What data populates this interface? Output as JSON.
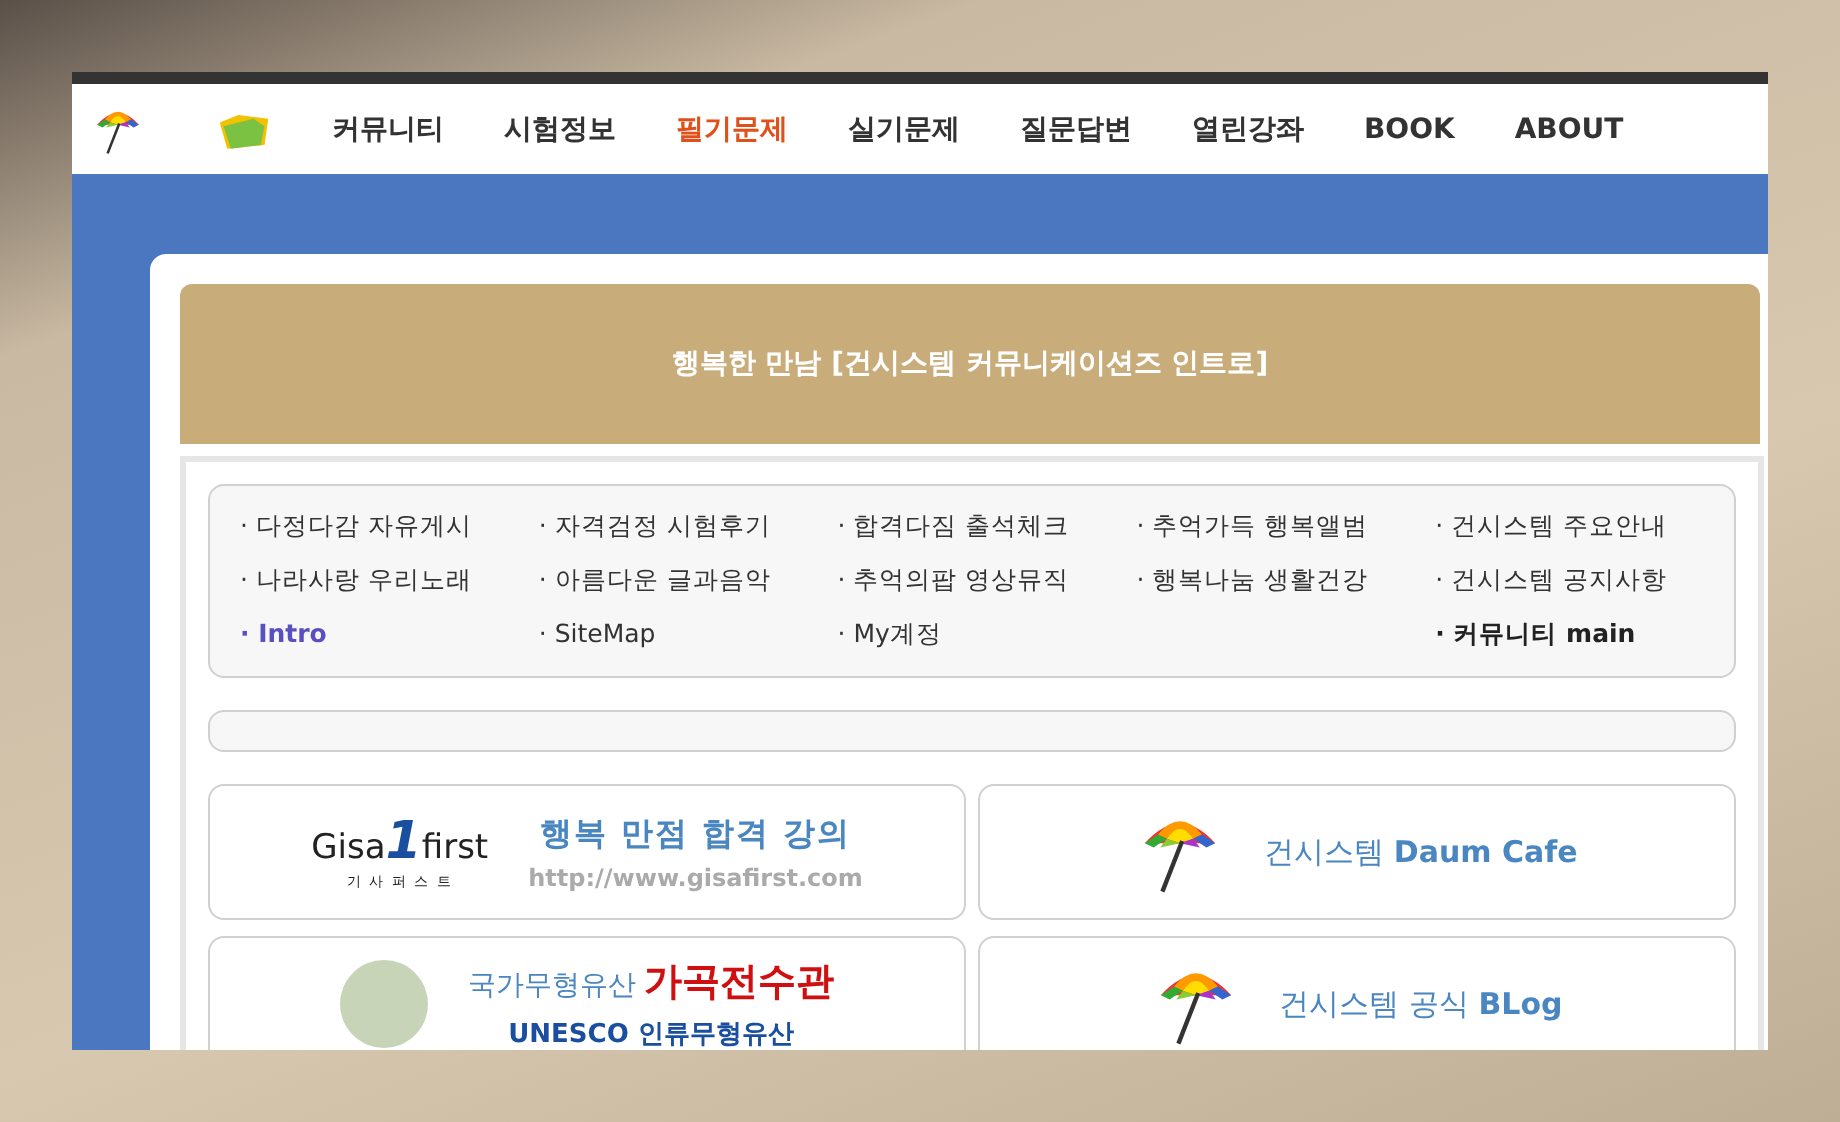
{
  "nav": {
    "items": [
      {
        "label": "커뮤니티",
        "selected": false
      },
      {
        "label": "시험정보",
        "selected": false
      },
      {
        "label": "필기문제",
        "selected": true
      },
      {
        "label": "실기문제",
        "selected": false
      },
      {
        "label": "질문답변",
        "selected": false
      },
      {
        "label": "열린강좌",
        "selected": false
      },
      {
        "label": "BOOK",
        "selected": false
      },
      {
        "label": "ABOUT",
        "selected": false
      }
    ]
  },
  "banner": {
    "title": "행복한 만남 [건시스템 커뮤니케이션즈 인트로]"
  },
  "link_columns": [
    [
      {
        "label": "· 다정다감 자유게시",
        "kind": "plain"
      },
      {
        "label": "· 나라사랑 우리노래",
        "kind": "plain"
      },
      {
        "label": "· Intro",
        "kind": "highlight"
      }
    ],
    [
      {
        "label": "· 자격검정 시험후기",
        "kind": "plain"
      },
      {
        "label": "· 아름다운 글과음악",
        "kind": "plain"
      },
      {
        "label": "· SiteMap",
        "kind": "plain"
      }
    ],
    [
      {
        "label": "· 합격다짐 출석체크",
        "kind": "plain"
      },
      {
        "label": "· 추억의팝 영상뮤직",
        "kind": "plain"
      },
      {
        "label": "· My계정",
        "kind": "plain"
      }
    ],
    [
      {
        "label": "· 추억가득 행복앨범",
        "kind": "plain"
      },
      {
        "label": "· 행복나눔 생활건강",
        "kind": "plain"
      }
    ],
    [
      {
        "label": "· 건시스템 주요안내",
        "kind": "plain"
      },
      {
        "label": "· 건시스템 공지사항",
        "kind": "plain"
      },
      {
        "label": "· 커뮤니티 main",
        "kind": "bold"
      }
    ]
  ],
  "cards": [
    {
      "kind": "gisafirst",
      "logo_text": "Gisa",
      "logo_number": "1",
      "logo_text_2": "first",
      "logo_sub": "기 사 퍼 스 트",
      "title": "행복 만점 합격 강의",
      "url": "http://www.gisafirst.com"
    },
    {
      "kind": "umbrella",
      "title": "건시스템 ",
      "title_bold": "Daum Cafe"
    },
    {
      "kind": "portrait",
      "title": "국가무형유산 ",
      "title_bold": "가곡전수관",
      "subtitle": "UNESCO 인류무형유산"
    },
    {
      "kind": "umbrella",
      "title": "건시스템 공식 ",
      "title_bold": "BLog"
    }
  ]
}
